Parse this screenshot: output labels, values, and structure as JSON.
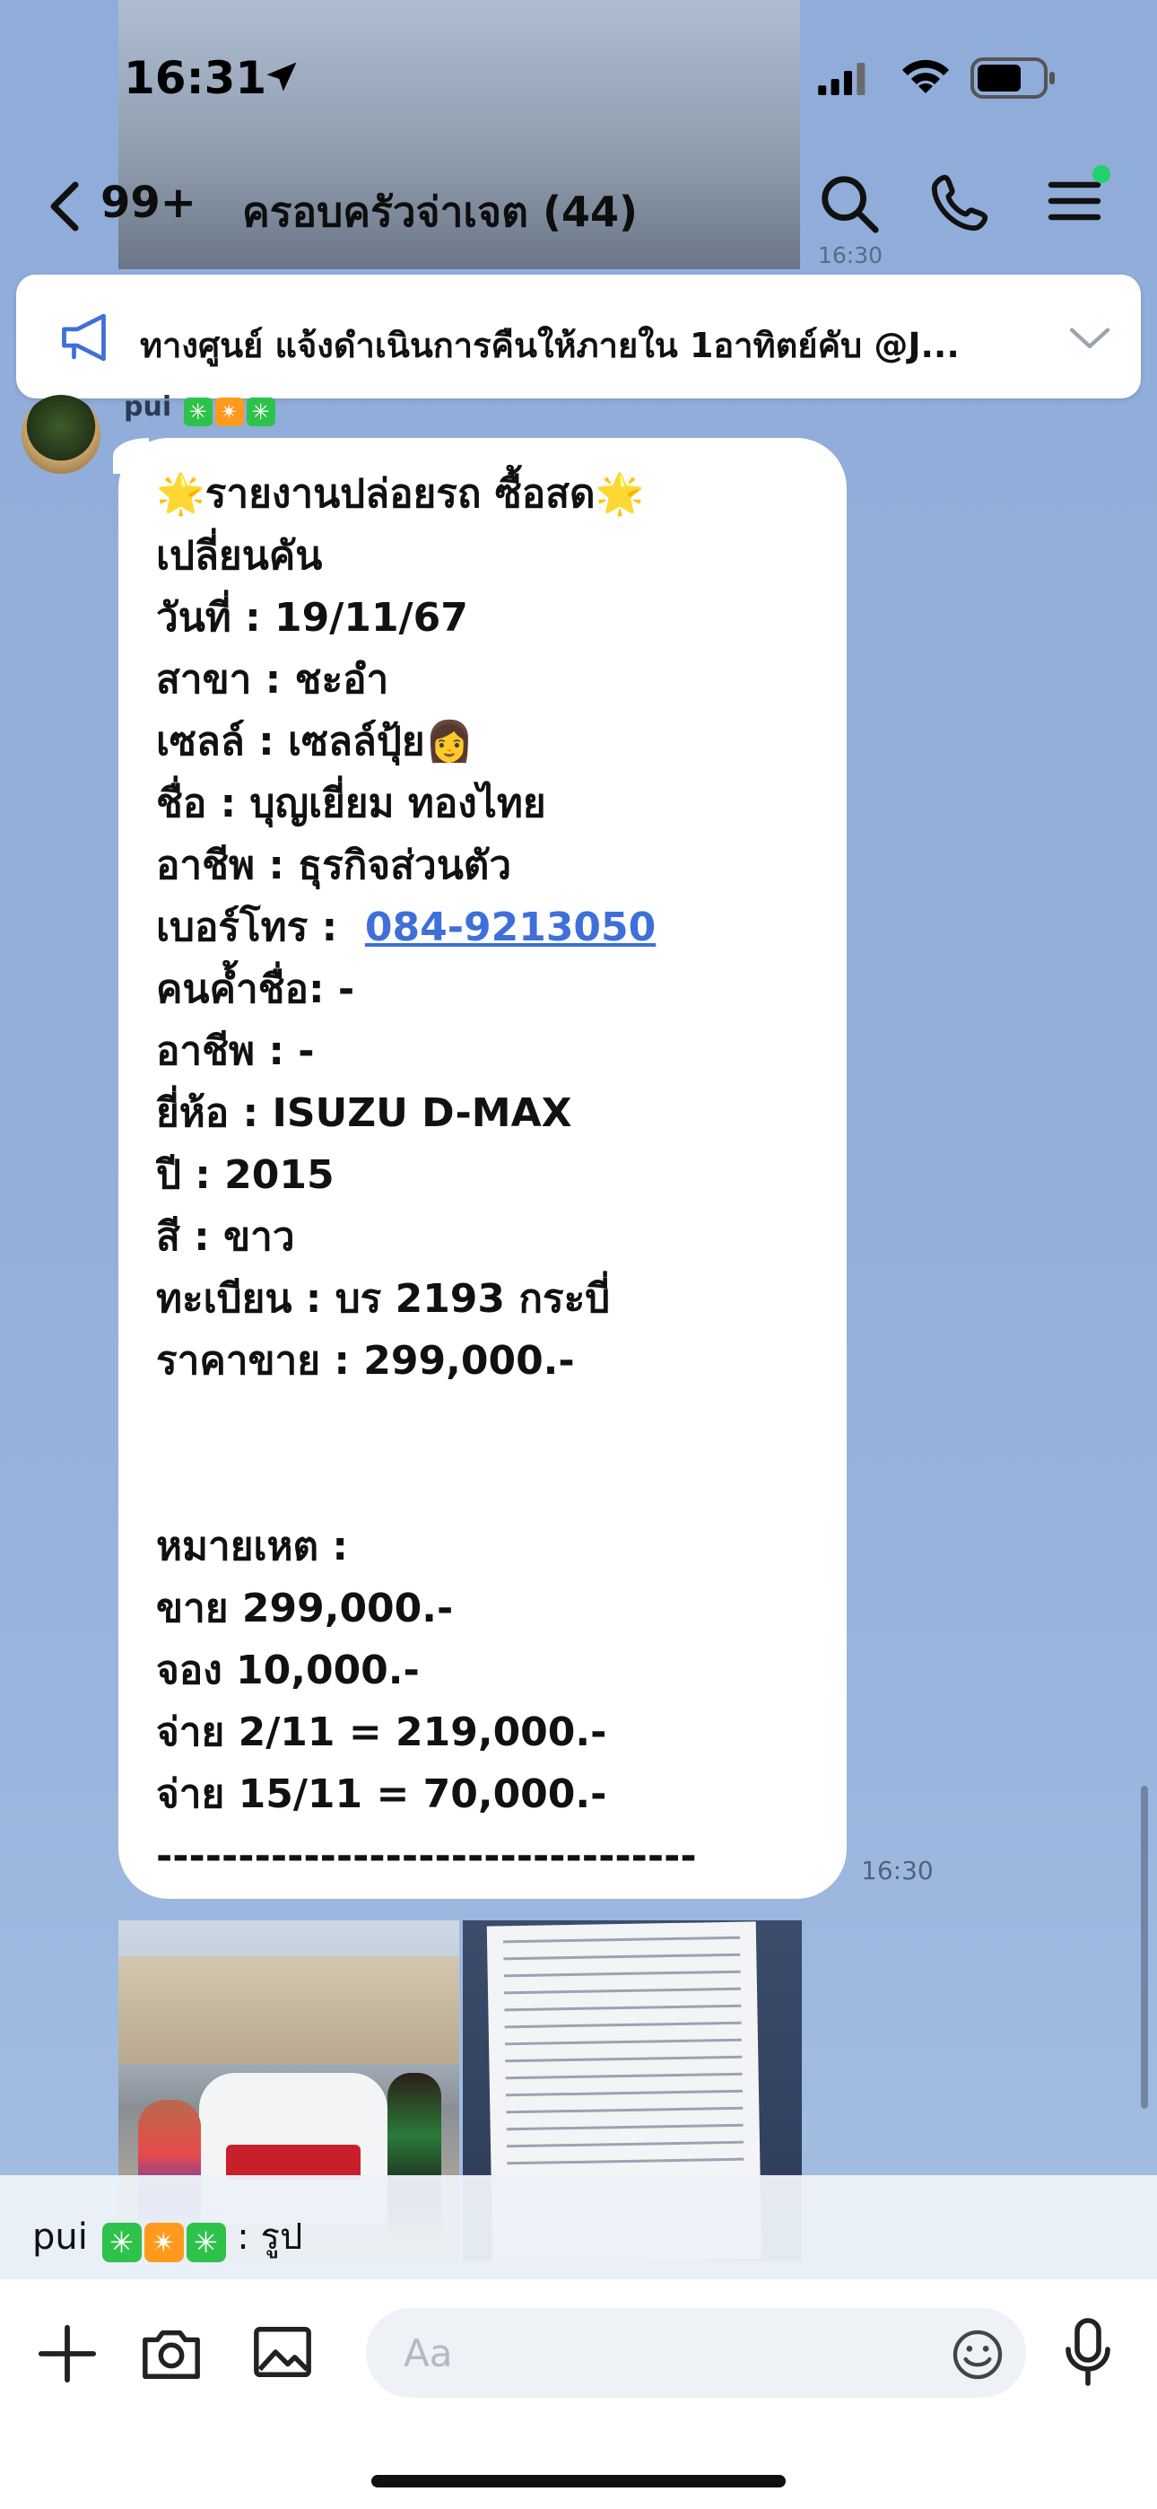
{
  "status_bar": {
    "time": "16:31"
  },
  "header": {
    "back_count": "99+",
    "title": "ครอบครัวจ่าเจต (44)"
  },
  "previous_message": {
    "time": "16:30"
  },
  "announcement": {
    "text": "ทางศูนย์ แจ้งดำเนินการคืนให้ภายใน 1อาทิตย์คับ @J..."
  },
  "sender": {
    "name": "pui"
  },
  "message": {
    "lines": [
      "🌟รายงานปล่อยรถ ซื้อสด🌟",
      "เปลี่ยนคัน",
      "วันที่ : 19/11/67",
      "สาขา : ชะอำ",
      "เซลล์ : เซลล์ปุ้ย👩",
      "ชื่อ : บุญเยี่ยม ทองไทย",
      "อาชีพ : ธุรกิจส่วนตัว",
      "เบอร์โทร : ",
      "คนค้ำชื่อ: -",
      "อาชีพ : -",
      "ยี่ห้อ : ISUZU D-MAX",
      "ปี : 2015",
      "สี : ขาว",
      "ทะเบียน : บร 2193 กระบี่",
      "ราคาขาย : 299,000.-",
      "",
      "",
      "หมายเหต :",
      "ขาย 299,000.-",
      "จอง 10,000.-",
      "จ่าย 2/11 = 219,000.-",
      "จ่าย 15/11 = 70,000.-",
      "---------------------------------"
    ],
    "phone": "084-9213050",
    "time": "16:30"
  },
  "reply_preview": {
    "name": "pui",
    "suffix": ": รูป"
  },
  "composer": {
    "placeholder": "Aa"
  },
  "colors": {
    "accent_link": "#3f6fd8",
    "online_dot": "#22d16b",
    "badge_green": "#2ec24b",
    "badge_orange": "#ff9a1f"
  }
}
